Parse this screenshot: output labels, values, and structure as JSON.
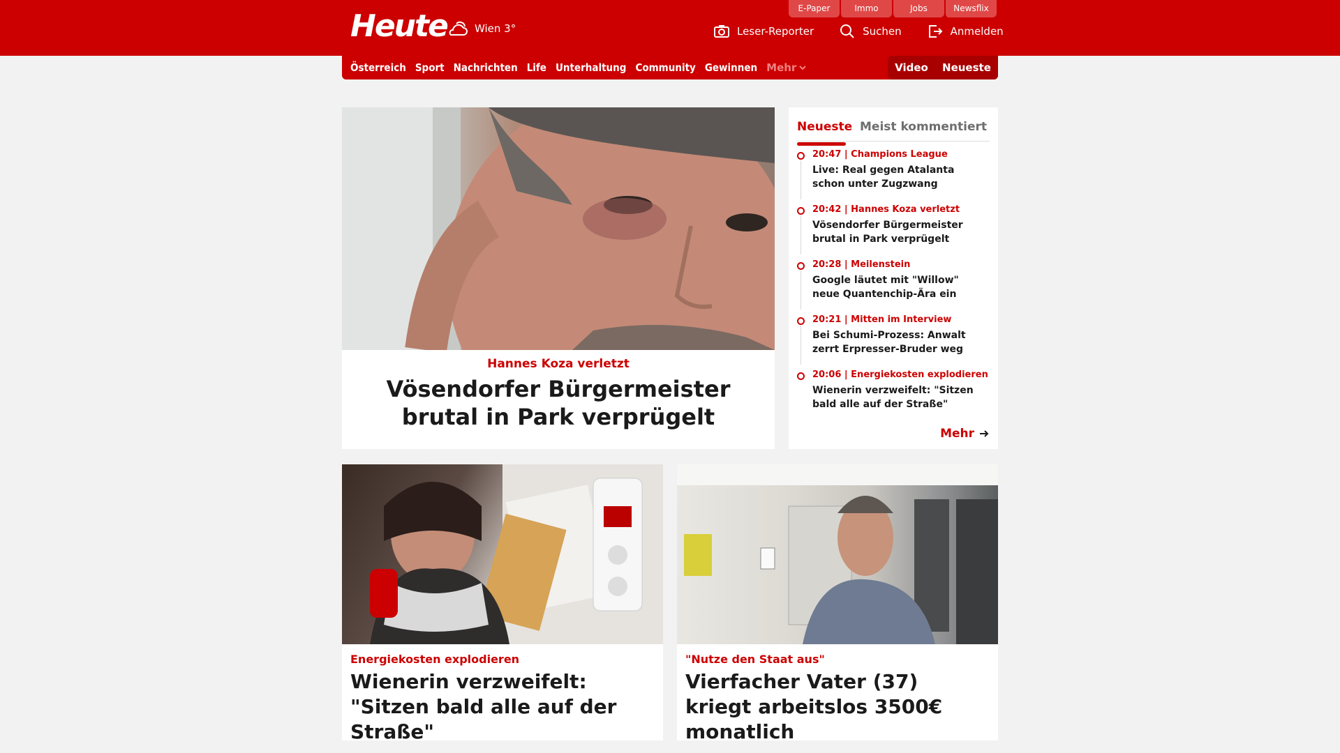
{
  "header": {
    "logo": "Heute",
    "weather": "Wien 3°",
    "util_links": [
      "E-Paper",
      "Immo",
      "Jobs",
      "Newsflix"
    ],
    "actions": {
      "reporter": "Leser-Reporter",
      "search": "Suchen",
      "login": "Anmelden"
    },
    "colors": {
      "brand": "#cc0000"
    }
  },
  "nav": {
    "items": [
      "Österreich",
      "Sport",
      "Nachrichten",
      "Life",
      "Unterhaltung",
      "Community",
      "Gewinnen"
    ],
    "more": "Mehr",
    "right": [
      "Video",
      "Neueste"
    ]
  },
  "hero": {
    "kicker": "Hannes Koza verletzt",
    "title": "Vösendorfer Bürgermeister brutal in Park verprügelt"
  },
  "sidebar": {
    "tabs": [
      "Neueste",
      "Meist kommentiert"
    ],
    "items": [
      {
        "meta": "20:47 | Champions League",
        "text": "Live: Real gegen Atalanta schon unter Zugzwang"
      },
      {
        "meta": "20:42 | Hannes Koza verletzt",
        "text": "Vösendorfer Bürgermeister brutal in Park verprügelt"
      },
      {
        "meta": "20:28 | Meilenstein",
        "text": "Google läutet mit \"Willow\" neue Quantenchip-Ära ein"
      },
      {
        "meta": "20:21 | Mitten im Interview",
        "text": "Bei Schumi-Prozess: Anwalt zerrt Erpresser-Bruder weg"
      },
      {
        "meta": "20:06 | Energiekosten explodieren",
        "text": "Wienerin verzweifelt: \"Sitzen bald alle auf der Straße\""
      }
    ],
    "more": "Mehr"
  },
  "cards": [
    {
      "kicker": "Energiekosten explodieren",
      "title": "Wienerin verzweifelt: \"Sitzen bald alle auf der Straße\""
    },
    {
      "kicker": "\"Nutze den Staat aus\"",
      "title": "Vierfacher Vater (37) kriegt arbeitslos 3500€ monatlich"
    }
  ]
}
